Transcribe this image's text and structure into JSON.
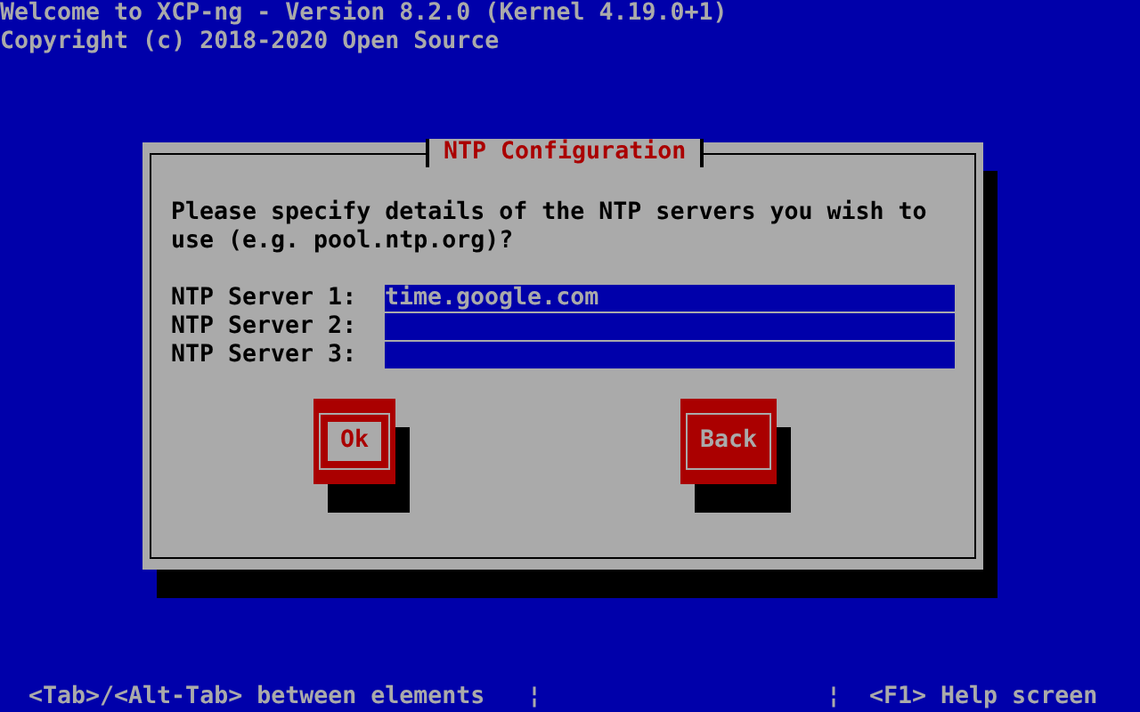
{
  "header": [
    "Welcome to XCP-ng - Version 8.2.0 (Kernel 4.19.0+1)",
    "Copyright (c) 2018-2020 Open Source"
  ],
  "dialog": {
    "title": "NTP Configuration",
    "message": "Please specify details of the NTP servers you wish to use (e.g. pool.ntp.org)?",
    "fields": [
      {
        "label": "NTP Server 1:",
        "value": "time.google.com"
      },
      {
        "label": "NTP Server 2:"
      },
      {
        "label": "NTP Server 3:"
      }
    ],
    "buttons": [
      {
        "label": "Ok",
        "selected": true
      },
      {
        "label": "Back",
        "selected": false
      }
    ]
  },
  "status_bar": {
    "left": "<Tab>/<Alt-Tab> between elements",
    "separators": [
      "¦",
      "¦"
    ],
    "right": "<F1> Help screen"
  }
}
